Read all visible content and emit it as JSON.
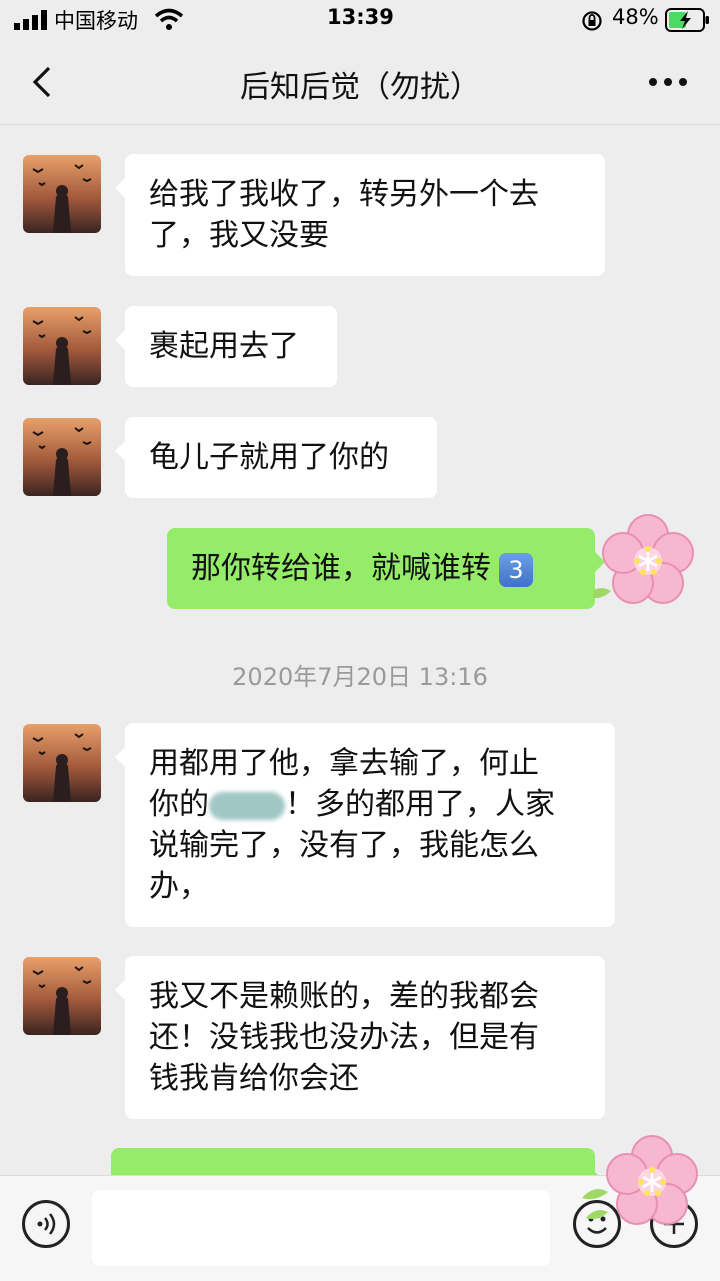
{
  "status_bar": {
    "carrier": "中国移动",
    "time": "13:39",
    "battery": "48%"
  },
  "nav": {
    "title": "后知后觉（勿扰）",
    "back_icon": "chevron-left-icon",
    "more_icon": "more-dots-icon"
  },
  "messages": [
    {
      "side": "left",
      "lines": [
        "给我了我收了，转另外一个去",
        "了，我又没要"
      ]
    },
    {
      "side": "left",
      "lines": [
        "裹起用去了"
      ]
    },
    {
      "side": "left",
      "lines": [
        "龟儿子就用了你的"
      ]
    },
    {
      "side": "right",
      "lines": [
        "那你转给谁，就喊谁转"
      ],
      "badge": "3"
    },
    {
      "side": "time",
      "text": "2020年7月20日 13:16"
    },
    {
      "side": "left",
      "lines": [
        "用都用了他，拿去输了，何止",
        "你的",
        "！多的都用了，人家",
        "说输完了，没有了，我能怎么",
        "办，"
      ]
    },
    {
      "side": "left",
      "lines": [
        "我又不是赖账的，差的我都会",
        "还！没钱我也没办法，但是有",
        "钱我肯给你会还"
      ]
    }
  ],
  "input_bar": {
    "voice_icon": "voice-icon",
    "emoji_icon": "emoji-icon",
    "plus_icon": "plus-icon",
    "input_value": ""
  },
  "colors": {
    "background": "#ededed",
    "bubble_left": "#ffffff",
    "bubble_right": "#95ec69"
  }
}
